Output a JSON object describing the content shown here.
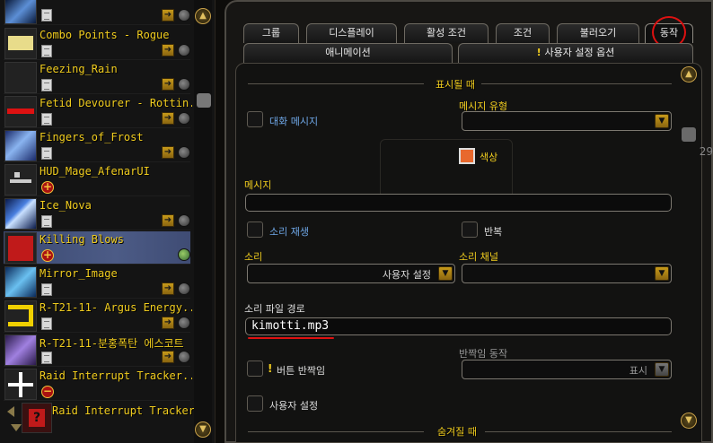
{
  "sidebar": {
    "items": [
      {
        "label": "",
        "icon": "frost-icon"
      },
      {
        "label": "Combo Points - Rogue",
        "icon": "yellow-bar-icon"
      },
      {
        "label": "Feezing_Rain",
        "icon": "empty-icon"
      },
      {
        "label": "Fetid Devourer - Rottin...",
        "icon": "red-bar-icon"
      },
      {
        "label": "Fingers_of_Frost",
        "icon": "frost-fingers-icon"
      },
      {
        "label": "HUD_Mage_AfenarUI",
        "icon": "hud-icon"
      },
      {
        "label": "Ice_Nova",
        "icon": "ice-nova-icon"
      },
      {
        "label": "Killing Blows",
        "icon": "red-square-icon"
      },
      {
        "label": "Mirror_Image",
        "icon": "mirror-image-icon"
      },
      {
        "label": "R-T21-11- Argus Energy...",
        "icon": "energy-bar-icon"
      },
      {
        "label": "R-T21-11-분홍폭탄 에스코트",
        "icon": "escort-icon"
      },
      {
        "label": "Raid Interrupt Tracker...",
        "icon": "cross-icon"
      },
      {
        "label": "Raid Interrupt Tracker",
        "icon": "question-icon"
      }
    ]
  },
  "tabs_row1": [
    "그룹",
    "디스플레이",
    "활성 조건",
    "조건",
    "불러오기",
    "동작"
  ],
  "tabs_row2": [
    "애니메이션",
    "사용자 설정 옵션"
  ],
  "section_show": "표시될 때",
  "section_hide": "숨겨질 때",
  "chat_message_label": "대화 메시지",
  "message_type_label": "메시지 유형",
  "color_label": "색상",
  "message_label": "메시지",
  "play_sound_label": "소리 재생",
  "repeat_label": "반복",
  "sound_label": "소리",
  "sound_value": "사용자 설정",
  "sound_channel_label": "소리 채널",
  "sound_file_path_label": "소리 파일 경로",
  "sound_file_path_value": "kimotti.mp3",
  "glow_action_label": "반짝임 동작",
  "glow_action_value": "표시",
  "button_glow_label": "버튼 반짝임",
  "custom_label": "사용자 설정",
  "edge_number": "29",
  "colors": {
    "gold": "#f0cc1e",
    "blue": "#6fa8e8",
    "swatch": "#e8682d",
    "annotation": "#d11111"
  }
}
